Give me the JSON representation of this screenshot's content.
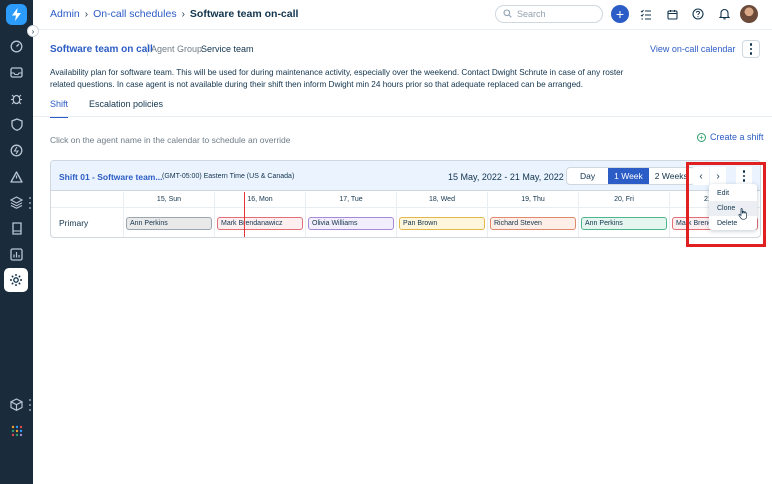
{
  "breadcrumb": {
    "items": [
      "Admin",
      "On-call schedules"
    ],
    "current": "Software team on-call"
  },
  "search": {
    "placeholder": "Search"
  },
  "header": {
    "title": "Software team on call",
    "agent_group_label": "Agent Group",
    "agent_group_value": "Service team",
    "view_calendar_link": "View on-call calendar",
    "description": "Availability plan for software team. This will be used for during maintenance activity, especially over the weekend. Contact Dwight Schrute in case of any roster related questions. In case agent is not available during their shift then inform Dwight min 24 hours prior so that adequate replaced can be arranged."
  },
  "tabs": [
    {
      "label": "Shift",
      "active": true
    },
    {
      "label": "Escalation policies",
      "active": false
    }
  ],
  "hint": "Click on the agent name in the calendar to schedule an override",
  "create_shift_label": "Create a shift",
  "shift": {
    "name": "Shift 01 - Software team...",
    "timezone": "(GMT-05:00) Eastern Time (US & Canada)",
    "date_range": "15 May, 2022 - 21 May, 2022",
    "views": [
      "Day",
      "1 Week",
      "2 Weeks"
    ],
    "selected_view": "1 Week",
    "days": [
      "15, Sun",
      "16, Mon",
      "17, Tue",
      "18, Wed",
      "19, Thu",
      "20, Fri",
      "21"
    ],
    "row_label": "Primary",
    "assignments": [
      {
        "name": "Ann Perkins",
        "color": "#e9e9e9",
        "border": "#9aa6b1"
      },
      {
        "name": "Mark Brendanawicz",
        "color": "#fdeff0",
        "border": "#e26e76"
      },
      {
        "name": "Olivia Williams",
        "color": "#f3eefc",
        "border": "#a58ad8"
      },
      {
        "name": "Pan Brown",
        "color": "#fff6dc",
        "border": "#e4b74d"
      },
      {
        "name": "Richard Steven",
        "color": "#fdeee7",
        "border": "#e08a6d"
      },
      {
        "name": "Ann Perkins",
        "color": "#e4f6ef",
        "border": "#4fb58d"
      },
      {
        "name": "Mark Brendanawicz",
        "color": "#fdeff0",
        "border": "#e26e76"
      }
    ]
  },
  "menu": {
    "items": [
      "Edit",
      "Clone",
      "Delete"
    ],
    "hovered": "Clone"
  },
  "colors": {
    "nav_bg": "#1a2b3c",
    "accent": "#2c5cc5",
    "highlight": "#e02020",
    "now_line": "#e43538"
  }
}
